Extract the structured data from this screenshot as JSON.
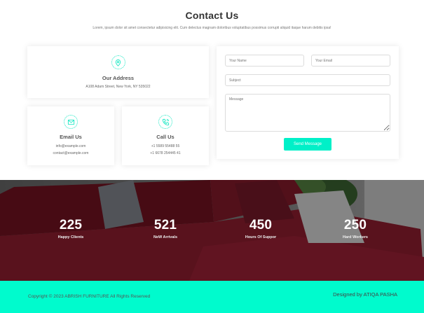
{
  "contact": {
    "title": "Contact Us",
    "description": "Lorem, ipsum dolor sit amet consectetur adipisicing elit. Cum delectus magnam doloribus voluptatibus possimus corrupti aliquid itaque harum debitis ipsa!",
    "address": {
      "icon": "map-pin-icon",
      "title": "Our Address",
      "line": "A108 Adam Street, New York, NY 535022"
    },
    "email": {
      "icon": "envelope-icon",
      "title": "Email Us",
      "lines": [
        "info@example.com",
        "contact@example.com"
      ]
    },
    "call": {
      "icon": "phone-icon",
      "title": "Call Us",
      "lines": [
        "+1 5589 55488 55",
        "+1 6678 254445 41"
      ]
    }
  },
  "form": {
    "name_placeholder": "Your Name",
    "email_placeholder": "Your Email",
    "subject_placeholder": "Subject",
    "message_placeholder": "Message",
    "send_label": "Send Message"
  },
  "stats": [
    {
      "number": "225",
      "label": "Happy Clients"
    },
    {
      "number": "521",
      "label": "NeW Arrivals"
    },
    {
      "number": "450",
      "label": "Hours Of Suppor"
    },
    {
      "number": "250",
      "label": "Hard Workers"
    }
  ],
  "footer": {
    "copyright": "Copyright © 2023 ABRISH FURNITURE All Rights Reserved",
    "designed_by": "Designed by ATIQA PASHA"
  },
  "colors": {
    "accent": "#00f0c8",
    "footer_bg": "#00fbcd",
    "sofa_red": "#8b1a2b"
  }
}
